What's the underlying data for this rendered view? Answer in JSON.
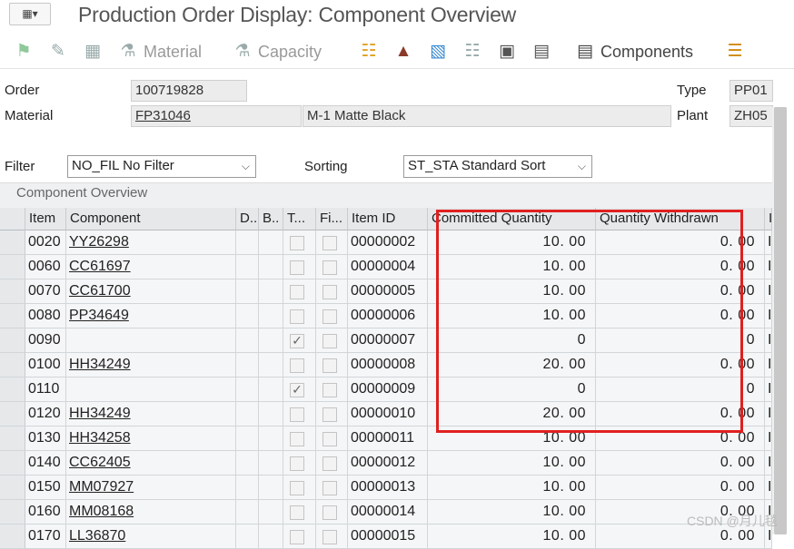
{
  "window": {
    "title": "Production Order Display: Component Overview",
    "menu_icon": "menu-icon"
  },
  "toolbar": {
    "material_label": "Material",
    "capacity_label": "Capacity",
    "components_label": "Components"
  },
  "header": {
    "order_label": "Order",
    "order_value": "100719828",
    "type_label": "Type",
    "type_value": "PP01",
    "material_label": "Material",
    "material_value": "FP31046",
    "material_desc": "M-1 Matte Black",
    "plant_label": "Plant",
    "plant_value": "ZH05"
  },
  "filter": {
    "filter_label": "Filter",
    "filter_value": "NO_FIL No Filter",
    "sorting_label": "Sorting",
    "sorting_value": "ST_STA Standard Sort"
  },
  "table": {
    "panel_title": "Component Overview",
    "columns": [
      "Item",
      "Component",
      "D..",
      "B..",
      "T...",
      "Fi...",
      "Item ID",
      "Committed Quantity",
      "Quantity Withdrawn",
      "I"
    ],
    "rows": [
      {
        "item": "0020",
        "component": "YY26298",
        "t": false,
        "item_id": "00000002",
        "committed": "10. 00",
        "withdrawn": "0. 00",
        "extra": "I"
      },
      {
        "item": "0060",
        "component": "CC61697",
        "t": false,
        "item_id": "00000004",
        "committed": "10. 00",
        "withdrawn": "0. 00",
        "extra": "I"
      },
      {
        "item": "0070",
        "component": "CC61700",
        "t": false,
        "item_id": "00000005",
        "committed": "10. 00",
        "withdrawn": "0. 00",
        "extra": "I"
      },
      {
        "item": "0080",
        "component": "PP34649",
        "t": false,
        "item_id": "00000006",
        "committed": "10. 00",
        "withdrawn": "0. 00",
        "extra": "I"
      },
      {
        "item": "0090",
        "component": "",
        "t": true,
        "item_id": "00000007",
        "committed": "0",
        "withdrawn": "0",
        "extra": "I"
      },
      {
        "item": "0100",
        "component": "HH34249",
        "t": false,
        "item_id": "00000008",
        "committed": "20. 00",
        "withdrawn": "0. 00",
        "extra": "I"
      },
      {
        "item": "0110",
        "component": "",
        "t": true,
        "item_id": "00000009",
        "committed": "0",
        "withdrawn": "0",
        "extra": "I"
      },
      {
        "item": "0120",
        "component": "HH34249",
        "t": false,
        "item_id": "00000010",
        "committed": "20. 00",
        "withdrawn": "0. 00",
        "extra": "I"
      },
      {
        "item": "0130",
        "component": "HH34258",
        "t": false,
        "item_id": "00000011",
        "committed": "10. 00",
        "withdrawn": "0. 00",
        "extra": "I"
      },
      {
        "item": "0140",
        "component": "CC62405",
        "t": false,
        "item_id": "00000012",
        "committed": "10. 00",
        "withdrawn": "0. 00",
        "extra": "I"
      },
      {
        "item": "0150",
        "component": "MM07927",
        "t": false,
        "item_id": "00000013",
        "committed": "10. 00",
        "withdrawn": "0. 00",
        "extra": "I"
      },
      {
        "item": "0160",
        "component": "MM08168",
        "t": false,
        "item_id": "00000014",
        "committed": "10. 00",
        "withdrawn": "0. 00",
        "extra": "I"
      },
      {
        "item": "0170",
        "component": "LL36870",
        "t": false,
        "item_id": "00000015",
        "committed": "10. 00",
        "withdrawn": "0. 00",
        "extra": "I"
      }
    ]
  },
  "watermark": "CSDN @月儿毯",
  "colors": {
    "highlight_box": "#e02020"
  }
}
